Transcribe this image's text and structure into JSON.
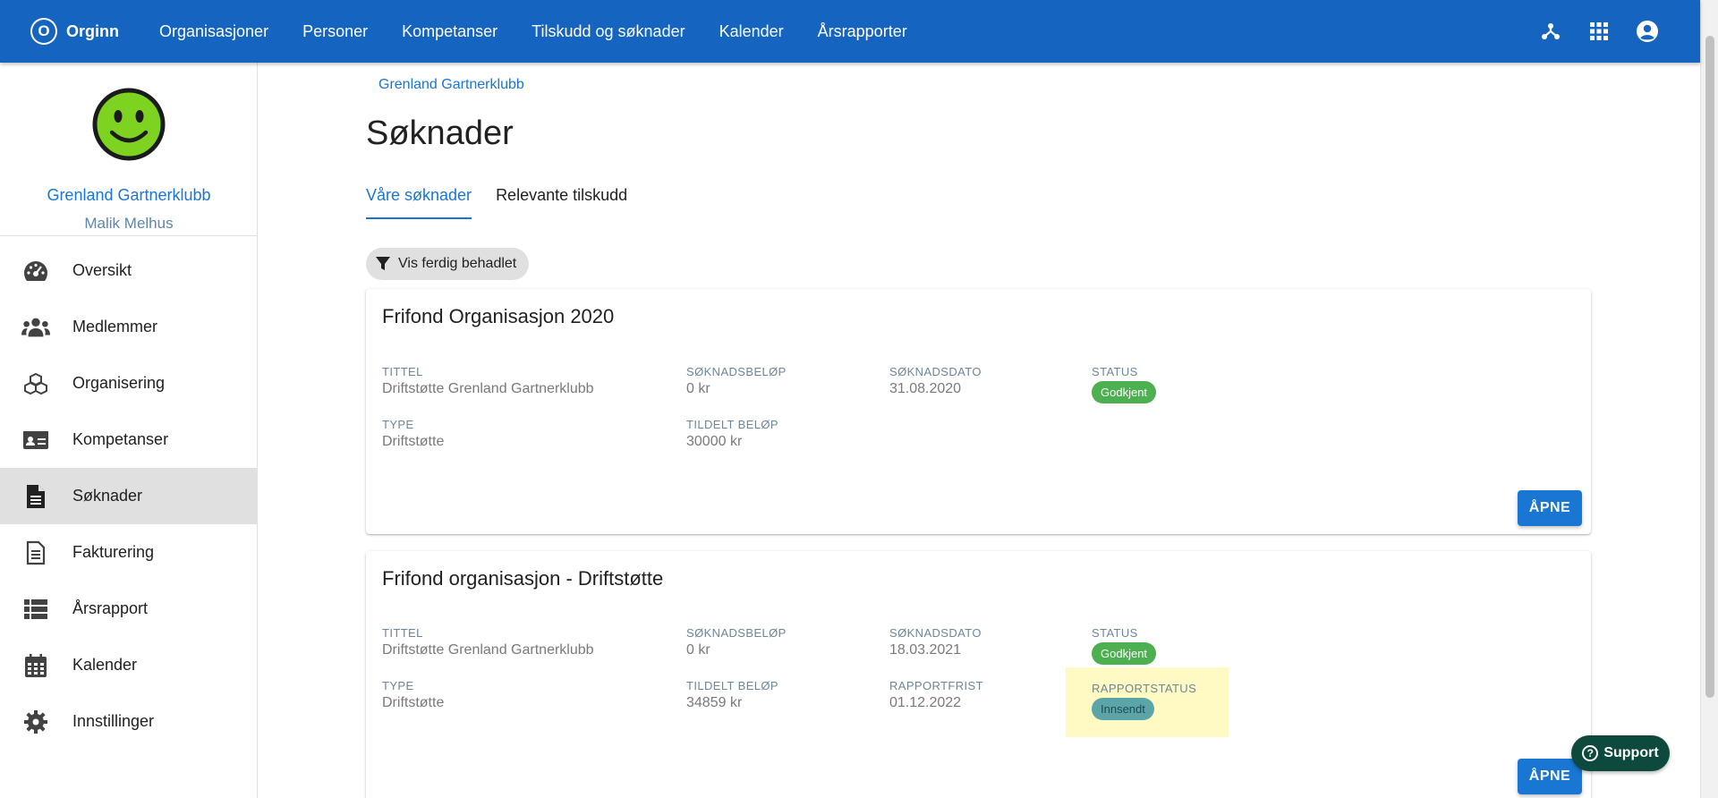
{
  "app": {
    "name": "Orginn",
    "logo_letter": "O"
  },
  "nav": {
    "items": [
      {
        "label": "Organisasjoner"
      },
      {
        "label": "Personer"
      },
      {
        "label": "Kompetanser"
      },
      {
        "label": "Tilskudd og søknader"
      },
      {
        "label": "Kalender"
      },
      {
        "label": "Årsrapporter"
      }
    ],
    "icons": [
      "org-structure-icon",
      "apps-grid-icon",
      "account-circle-icon"
    ]
  },
  "sidebar": {
    "org_name": "Grenland Gartnerklubb",
    "user_name": "Malik Melhus",
    "items": [
      {
        "label": "Oversikt",
        "icon": "speedometer-icon"
      },
      {
        "label": "Medlemmer",
        "icon": "people-icon"
      },
      {
        "label": "Organisering",
        "icon": "cubes-icon"
      },
      {
        "label": "Kompetanser",
        "icon": "id-card-icon"
      },
      {
        "label": "Søknader",
        "icon": "document-icon",
        "active": true
      },
      {
        "label": "Fakturering",
        "icon": "invoice-icon"
      },
      {
        "label": "Årsrapport",
        "icon": "list-icon"
      },
      {
        "label": "Kalender",
        "icon": "calendar-icon"
      },
      {
        "label": "Innstillinger",
        "icon": "gear-icon"
      }
    ]
  },
  "breadcrumb": "Grenland Gartnerklubb",
  "page_title": "Søknader",
  "tabs": [
    {
      "label": "Våre søknader",
      "active": true
    },
    {
      "label": "Relevante tilskudd"
    }
  ],
  "filter": {
    "label": "Vis ferdig behadlet"
  },
  "cards": [
    {
      "title": "Frifond Organisasjon 2020",
      "tittel_label": "TITTEL",
      "tittel": "Driftstøtte Grenland Gartnerklubb",
      "type_label": "TYPE",
      "type": "Driftstøtte",
      "soknadsbelop_label": "SØKNADSBELØP",
      "soknadsbelop": "0 kr",
      "tildelt_label": "TILDELT BELØP",
      "tildelt": "30000 kr",
      "soknadsdato_label": "SØKNADSDATO",
      "soknadsdato": "31.08.2020",
      "status_label": "STATUS",
      "status": "Godkjent",
      "button": "ÅPNE"
    },
    {
      "title": "Frifond organisasjon - Driftstøtte",
      "tittel_label": "TITTEL",
      "tittel": "Driftstøtte Grenland Gartnerklubb",
      "type_label": "TYPE",
      "type": "Driftstøtte",
      "soknadsbelop_label": "SØKNADSBELØP",
      "soknadsbelop": "0 kr",
      "tildelt_label": "TILDELT BELØP",
      "tildelt": "34859 kr",
      "soknadsdato_label": "SØKNADSDATO",
      "soknadsdato": "18.03.2021",
      "rapportfrist_label": "RAPPORTFRIST",
      "rapportfrist": "01.12.2022",
      "status_label": "STATUS",
      "status": "Godkjent",
      "rapportstatus_label": "RAPPORTSTATUS",
      "rapportstatus": "Innsendt",
      "button": "ÅPNE"
    }
  ],
  "support": {
    "label": "Support",
    "icon": "help-circle-icon"
  },
  "colors": {
    "primary": "#1565c0",
    "accent": "#1976d2",
    "success": "#4caf50",
    "highlight": "#fff9c4",
    "support": "#0d4a3d"
  }
}
